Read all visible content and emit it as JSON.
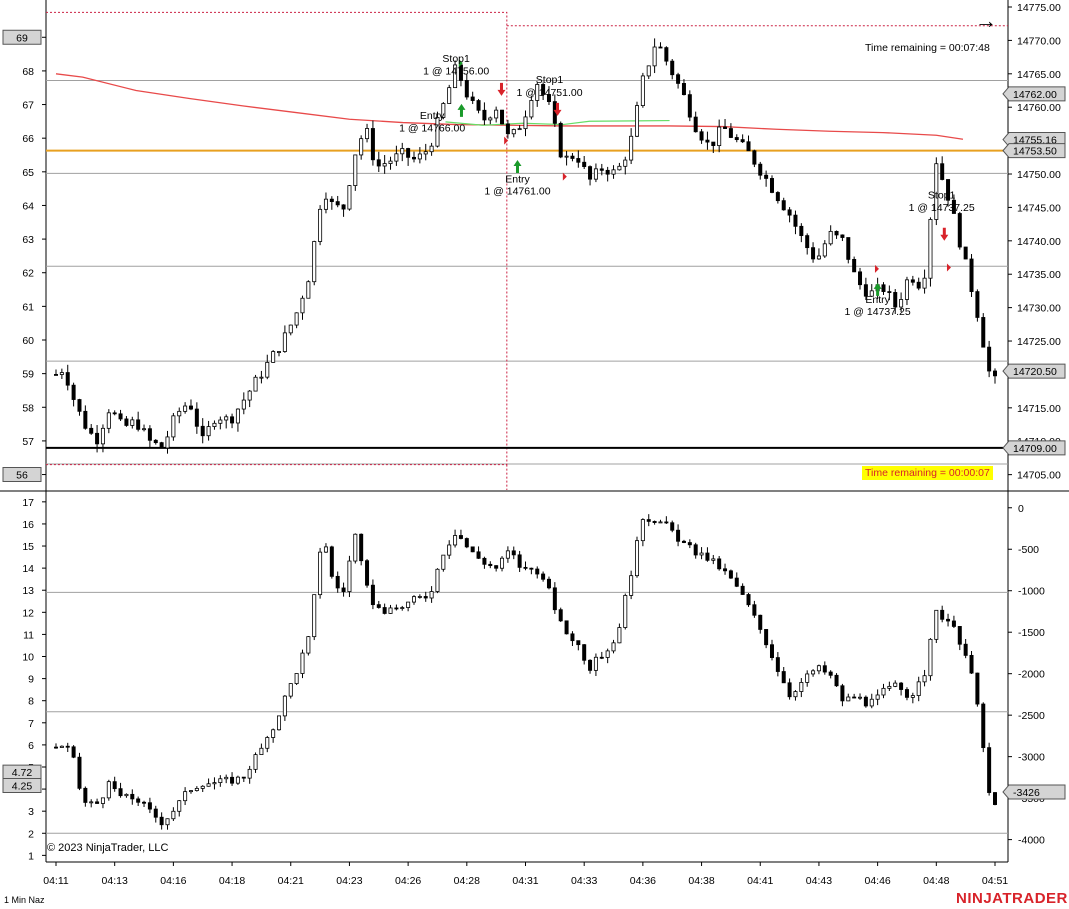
{
  "instrument_label": "1 Min Naz",
  "copyright": "© 2023 NinjaTrader, LLC",
  "brand": "NINJATRADER",
  "time_remaining_top": "Time remaining = 00:07:48",
  "time_remaining_bottom": "Time remaining = 00:00:07",
  "navigate_icon": "right-arrow-icon",
  "colors": {
    "ma": "#e84a4a",
    "level_orange": "#e8a020",
    "level_black": "#000000",
    "dashed_box": "#cc2244",
    "green_line": "#66dd66",
    "entry_arrow": "#1a9a2a",
    "stop_arrow": "#d8232a",
    "time_bg": "#ffff00"
  },
  "chart_data": [
    {
      "type": "candlestick",
      "panel": "price",
      "ylim": [
        14703,
        14775
      ],
      "right_ticks": [
        14705,
        14710,
        14715,
        14720,
        14725,
        14730,
        14735,
        14740,
        14745,
        14750,
        14755,
        14760,
        14765,
        14770,
        14775
      ],
      "right_tick_labels": [
        "14705.00",
        "14710.00",
        "14715.00",
        "14720.00",
        "14725.00",
        "14730.00",
        "14735.00",
        "14740.00",
        "14745.00",
        "14750.00",
        "14755.00",
        "14760.00",
        "14765.00",
        "14770.00",
        "14775.00"
      ],
      "left_ticks": [
        56,
        57,
        58,
        59,
        60,
        61,
        62,
        63,
        64,
        65,
        66,
        67,
        68,
        69
      ],
      "left_range": [
        55.6,
        69.9
      ],
      "left_markers": [
        "69",
        "56"
      ],
      "right_markers": [
        {
          "value": 14762.0,
          "label": "14762.00"
        },
        {
          "value": 14755.16,
          "label": "14755.16"
        },
        {
          "value": 14753.5,
          "label": "14753.50"
        },
        {
          "value": 14720.5,
          "label": "14720.50"
        },
        {
          "value": 14709.0,
          "label": "14709.00"
        }
      ],
      "levels": {
        "orange": 14753.5,
        "black": 14709.0,
        "grey": [
          14764.0,
          14750.1,
          14736.2,
          14722.0,
          14706.6
        ]
      },
      "box": {
        "x_start": 0,
        "x_end": 16.9,
        "y_top": 14774.2,
        "y_bottom": 14706.5,
        "y_top_right": 14772.2
      },
      "annotations": [
        {
          "text": "Stop1",
          "x": 15.0,
          "y": 14766.8
        },
        {
          "text": "1 @ 14756.00",
          "x": 15.0,
          "y": 14764.9
        },
        {
          "text": "Entry",
          "x": 14.1,
          "y": 14758.2
        },
        {
          "text": "1 @ 14766.00",
          "x": 14.1,
          "y": 14756.4
        },
        {
          "text": "Stop1",
          "x": 18.5,
          "y": 14763.6
        },
        {
          "text": "1 @ 14751.00",
          "x": 18.5,
          "y": 14761.7
        },
        {
          "text": "Entry",
          "x": 17.3,
          "y": 14748.7
        },
        {
          "text": "1 @ 14761.00",
          "x": 17.3,
          "y": 14746.9
        },
        {
          "text": "Stop1",
          "x": 33.2,
          "y": 14746.3
        },
        {
          "text": "1 @ 14737.25",
          "x": 33.2,
          "y": 14744.5
        },
        {
          "text": "Entry",
          "x": 30.8,
          "y": 14730.7
        },
        {
          "text": "1 @ 14737.25",
          "x": 30.8,
          "y": 14728.9
        }
      ],
      "markers": [
        {
          "kind": "entry-up",
          "x": 15.2,
          "y": 14759.6
        },
        {
          "kind": "entry-up",
          "x": 17.3,
          "y": 14751.2
        },
        {
          "kind": "entry-up",
          "x": 30.8,
          "y": 14732.8
        },
        {
          "kind": "stop-down",
          "x": 16.7,
          "y": 14762.6
        },
        {
          "kind": "stop-down",
          "x": 18.8,
          "y": 14759.6
        },
        {
          "kind": "stop-down",
          "x": 33.3,
          "y": 14740.9
        },
        {
          "kind": "flag",
          "x": 15.1,
          "y": 14766.6
        },
        {
          "kind": "flag",
          "x": 16.8,
          "y": 14755.0
        },
        {
          "kind": "flag",
          "x": 19.0,
          "y": 14749.6
        },
        {
          "kind": "flag",
          "x": 30.7,
          "y": 14735.8
        },
        {
          "kind": "flag",
          "x": 33.4,
          "y": 14736.0
        }
      ],
      "ma": [
        [
          0,
          14765
        ],
        [
          1,
          14764.5
        ],
        [
          3,
          14762.5
        ],
        [
          5,
          14761.3
        ],
        [
          7,
          14760.2
        ],
        [
          9,
          14759.2
        ],
        [
          11,
          14758.2
        ],
        [
          13,
          14757.7
        ],
        [
          15,
          14757.4
        ],
        [
          17,
          14757.3
        ],
        [
          19,
          14757.2
        ],
        [
          21,
          14757.2
        ],
        [
          23,
          14757.2
        ],
        [
          25,
          14757.1
        ],
        [
          27,
          14756.7
        ],
        [
          29,
          14756.4
        ],
        [
          31,
          14756.2
        ],
        [
          33,
          14755.8
        ],
        [
          34,
          14755.2
        ]
      ],
      "green_line": [
        [
          14.6,
          14757.8
        ],
        [
          16,
          14757.3
        ],
        [
          17.5,
          14757.6
        ],
        [
          19,
          14757.4
        ],
        [
          20,
          14757.9
        ],
        [
          23,
          14758.0
        ]
      ],
      "x_ticks": [
        0,
        2,
        4,
        6,
        8,
        10,
        12,
        14,
        16,
        18,
        20,
        22,
        24,
        26,
        28,
        30,
        32,
        34
      ],
      "x_tick_labels": [
        "04:11",
        "04:13",
        "04:16",
        "04:18",
        "04:21",
        "04:23",
        "04:26",
        "04:28",
        "04:31",
        "04:33",
        "04:36",
        "04:38",
        "04:41",
        "04:43",
        "04:46",
        "04:48",
        "04:51"
      ],
      "close_path": [
        [
          0,
          14720.0
        ],
        [
          0.3,
          14721
        ],
        [
          0.6,
          14717
        ],
        [
          1,
          14713
        ],
        [
          1.5,
          14710
        ],
        [
          2,
          14715
        ],
        [
          2.5,
          14712
        ],
        [
          3,
          14713
        ],
        [
          3.5,
          14710
        ],
        [
          4,
          14709
        ],
        [
          4.5,
          14714
        ],
        [
          5,
          14716
        ],
        [
          5.5,
          14710
        ],
        [
          6,
          14714
        ],
        [
          6.5,
          14713
        ],
        [
          7,
          14716
        ],
        [
          7.5,
          14719
        ],
        [
          8,
          14722
        ],
        [
          8.5,
          14725
        ],
        [
          9,
          14729
        ],
        [
          9.5,
          14735
        ],
        [
          10,
          14748
        ],
        [
          10.4,
          14745
        ],
        [
          10.8,
          14745
        ],
        [
          11.2,
          14753
        ],
        [
          11.6,
          14757
        ],
        [
          12,
          14751
        ],
        [
          12.5,
          14752
        ],
        [
          13,
          14753
        ],
        [
          13.5,
          14752
        ],
        [
          14,
          14754
        ],
        [
          14.5,
          14760
        ],
        [
          15,
          14766
        ],
        [
          15.5,
          14761
        ],
        [
          16,
          14758
        ],
        [
          16.5,
          14760
        ],
        [
          17,
          14755
        ],
        [
          17.5,
          14758
        ],
        [
          18,
          14764
        ],
        [
          18.5,
          14760
        ],
        [
          19,
          14752
        ],
        [
          19.5,
          14753
        ],
        [
          20,
          14749
        ],
        [
          20.5,
          14751
        ],
        [
          21,
          14750
        ],
        [
          21.5,
          14754
        ],
        [
          22,
          14764
        ],
        [
          22.5,
          14770
        ],
        [
          23,
          14766
        ],
        [
          23.5,
          14762
        ],
        [
          24,
          14757
        ],
        [
          24.5,
          14754
        ],
        [
          25,
          14757
        ],
        [
          25.5,
          14755
        ],
        [
          26,
          14753
        ],
        [
          26.5,
          14750
        ],
        [
          27,
          14747
        ],
        [
          27.5,
          14744
        ],
        [
          28,
          14740
        ],
        [
          28.5,
          14737
        ],
        [
          29,
          14741
        ],
        [
          29.5,
          14740
        ],
        [
          30,
          14734
        ],
        [
          30.5,
          14732
        ],
        [
          31,
          14733
        ],
        [
          31.5,
          14730
        ],
        [
          32,
          14735
        ],
        [
          32.5,
          14733
        ],
        [
          33,
          14752
        ],
        [
          33.5,
          14746
        ],
        [
          34,
          14738
        ],
        [
          34.5,
          14730
        ],
        [
          35,
          14720
        ],
        [
          35.2,
          14719
        ]
      ]
    },
    {
      "type": "candlestick",
      "panel": "indicator",
      "ylim": [
        0.7,
        17.4
      ],
      "left_ticks": [
        1,
        2,
        3,
        4,
        5,
        6,
        7,
        8,
        9,
        10,
        11,
        12,
        13,
        14,
        15,
        16,
        17
      ],
      "left_markers": [
        "4.72",
        "4.25"
      ],
      "right_ticks": [
        0,
        -500,
        -1000,
        -1500,
        -2000,
        -2500,
        -3000,
        -3500,
        -4000
      ],
      "right_tick_labels": [
        "0",
        "-500",
        "-1000",
        "-1500",
        "-2000",
        "-2500",
        "-3000",
        "-3500",
        "-4000"
      ],
      "right_range": [
        178,
        -4270
      ],
      "right_marker": {
        "value": -3426,
        "label": "-3426"
      },
      "grey": [
        12.9,
        7.5,
        2.0
      ],
      "close_path": [
        [
          0,
          5.9
        ],
        [
          0.3,
          6.0
        ],
        [
          0.6,
          5.6
        ],
        [
          1,
          3.4
        ],
        [
          1.5,
          3.3
        ],
        [
          2,
          4.2
        ],
        [
          2.5,
          3.6
        ],
        [
          3,
          3.6
        ],
        [
          3.5,
          3.0
        ],
        [
          4,
          2.5
        ],
        [
          4.5,
          3.2
        ],
        [
          5,
          4.0
        ],
        [
          5.5,
          4.3
        ],
        [
          6,
          4.3
        ],
        [
          6.5,
          4.4
        ],
        [
          7,
          4.5
        ],
        [
          7.5,
          5.5
        ],
        [
          8,
          6.3
        ],
        [
          8.5,
          7.9
        ],
        [
          9,
          9.3
        ],
        [
          9.5,
          10.9
        ],
        [
          10,
          15.8
        ],
        [
          10.4,
          13.2
        ],
        [
          10.8,
          13.0
        ],
        [
          11.2,
          15.6
        ],
        [
          11.6,
          13.2
        ],
        [
          12,
          12.2
        ],
        [
          12.5,
          12.0
        ],
        [
          13,
          12.3
        ],
        [
          13.5,
          12.6
        ],
        [
          14,
          12.8
        ],
        [
          14.5,
          14.7
        ],
        [
          15,
          15.7
        ],
        [
          15.5,
          14.8
        ],
        [
          16,
          14.3
        ],
        [
          16.5,
          14.0
        ],
        [
          17,
          14.8
        ],
        [
          17.5,
          13.9
        ],
        [
          18,
          14.0
        ],
        [
          18.5,
          12.9
        ],
        [
          19,
          11.2
        ],
        [
          19.5,
          10.7
        ],
        [
          20,
          9.5
        ],
        [
          20.5,
          10.1
        ],
        [
          21,
          10.8
        ],
        [
          21.5,
          13.5
        ],
        [
          22,
          16.3
        ],
        [
          22.5,
          16.2
        ],
        [
          23,
          15.8
        ],
        [
          23.5,
          15.1
        ],
        [
          24,
          14.7
        ],
        [
          24.5,
          14.4
        ],
        [
          25,
          13.9
        ],
        [
          25.5,
          13.2
        ],
        [
          26,
          12.2
        ],
        [
          26.5,
          11.0
        ],
        [
          27,
          9.6
        ],
        [
          27.5,
          8.3
        ],
        [
          28,
          8.9
        ],
        [
          28.5,
          9.5
        ],
        [
          29,
          9.2
        ],
        [
          29.5,
          8.0
        ],
        [
          30,
          8.2
        ],
        [
          30.5,
          7.8
        ],
        [
          31,
          8.4
        ],
        [
          31.5,
          8.7
        ],
        [
          32,
          8.2
        ],
        [
          32.5,
          8.9
        ],
        [
          33,
          12.0
        ],
        [
          33.5,
          11.6
        ],
        [
          34,
          10.3
        ],
        [
          34.5,
          8.4
        ],
        [
          35,
          3.5
        ],
        [
          35.2,
          3.3
        ]
      ]
    }
  ]
}
